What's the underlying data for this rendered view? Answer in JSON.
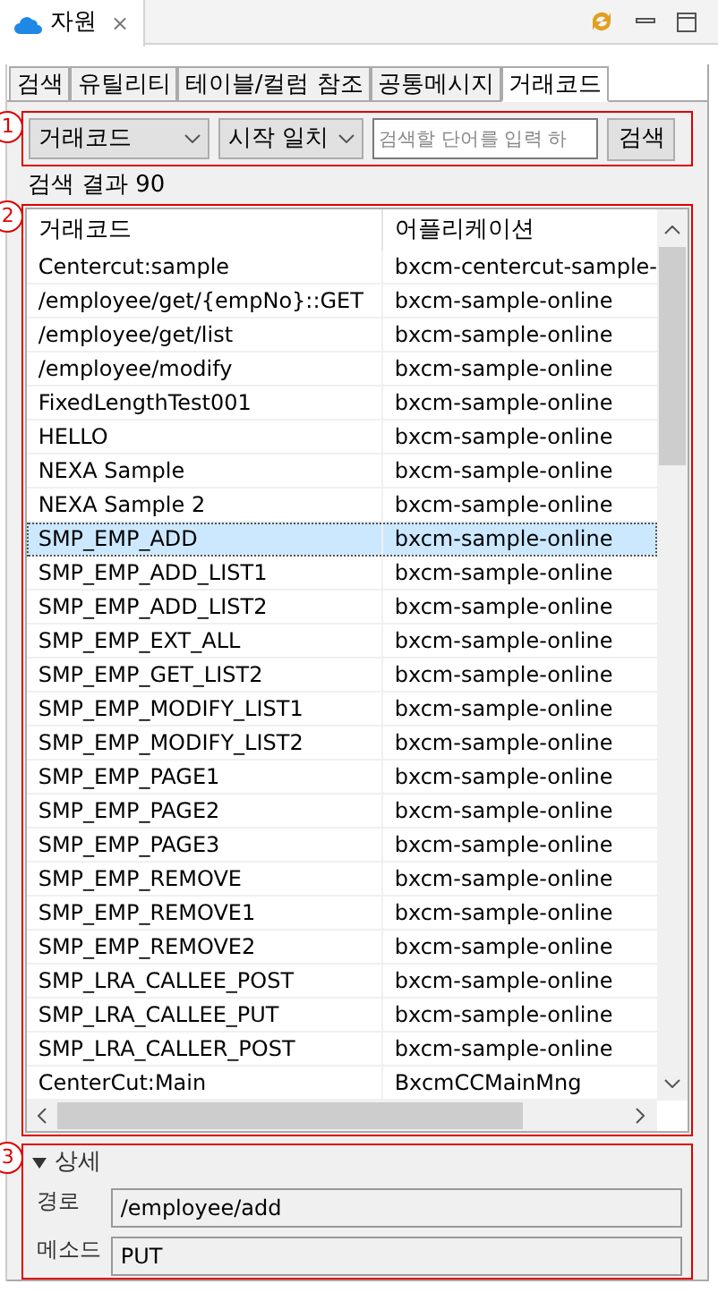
{
  "view_tab": {
    "title": "자원",
    "close": "⨯"
  },
  "tabs": [
    {
      "label": "검색",
      "selected": false
    },
    {
      "label": "유틸리티",
      "selected": false
    },
    {
      "label": "테이블/컬럼 참조",
      "selected": false
    },
    {
      "label": "공통메시지",
      "selected": false
    },
    {
      "label": "거래코드",
      "selected": true
    }
  ],
  "markers": [
    "1",
    "2",
    "3"
  ],
  "search": {
    "type_select": "거래코드",
    "match_select": "시작 일치",
    "placeholder": "검색할 단어를 입력 하",
    "button": "검색"
  },
  "result_count": "검색 결과 90",
  "table": {
    "columns": [
      "거래코드",
      "어플리케이션"
    ],
    "rows": [
      {
        "code": "Centercut:sample",
        "app": "bxcm-centercut-sample-",
        "selected": false
      },
      {
        "code": "/employee/get/{empNo}::GET",
        "app": "bxcm-sample-online",
        "selected": false
      },
      {
        "code": "/employee/get/list",
        "app": "bxcm-sample-online",
        "selected": false
      },
      {
        "code": "/employee/modify",
        "app": "bxcm-sample-online",
        "selected": false
      },
      {
        "code": "FixedLengthTest001",
        "app": "bxcm-sample-online",
        "selected": false
      },
      {
        "code": "HELLO",
        "app": "bxcm-sample-online",
        "selected": false
      },
      {
        "code": "NEXA Sample",
        "app": "bxcm-sample-online",
        "selected": false
      },
      {
        "code": "NEXA Sample 2",
        "app": "bxcm-sample-online",
        "selected": false
      },
      {
        "code": "SMP_EMP_ADD",
        "app": "bxcm-sample-online",
        "selected": true
      },
      {
        "code": "SMP_EMP_ADD_LIST1",
        "app": "bxcm-sample-online",
        "selected": false
      },
      {
        "code": "SMP_EMP_ADD_LIST2",
        "app": "bxcm-sample-online",
        "selected": false
      },
      {
        "code": "SMP_EMP_EXT_ALL",
        "app": "bxcm-sample-online",
        "selected": false
      },
      {
        "code": "SMP_EMP_GET_LIST2",
        "app": "bxcm-sample-online",
        "selected": false
      },
      {
        "code": "SMP_EMP_MODIFY_LIST1",
        "app": "bxcm-sample-online",
        "selected": false
      },
      {
        "code": "SMP_EMP_MODIFY_LIST2",
        "app": "bxcm-sample-online",
        "selected": false
      },
      {
        "code": "SMP_EMP_PAGE1",
        "app": "bxcm-sample-online",
        "selected": false
      },
      {
        "code": "SMP_EMP_PAGE2",
        "app": "bxcm-sample-online",
        "selected": false
      },
      {
        "code": "SMP_EMP_PAGE3",
        "app": "bxcm-sample-online",
        "selected": false
      },
      {
        "code": "SMP_EMP_REMOVE",
        "app": "bxcm-sample-online",
        "selected": false
      },
      {
        "code": "SMP_EMP_REMOVE1",
        "app": "bxcm-sample-online",
        "selected": false
      },
      {
        "code": "SMP_EMP_REMOVE2",
        "app": "bxcm-sample-online",
        "selected": false
      },
      {
        "code": "SMP_LRA_CALLEE_POST",
        "app": "bxcm-sample-online",
        "selected": false
      },
      {
        "code": "SMP_LRA_CALLEE_PUT",
        "app": "bxcm-sample-online",
        "selected": false
      },
      {
        "code": "SMP_LRA_CALLER_POST",
        "app": "bxcm-sample-online",
        "selected": false
      },
      {
        "code": "CenterCut:Main",
        "app": "BxcmCCMainMng",
        "selected": false
      }
    ]
  },
  "detail": {
    "title": "상세",
    "expanded": true,
    "fields": [
      {
        "label": "경로",
        "value": "/employee/add"
      },
      {
        "label": "메소드",
        "value": "PUT"
      }
    ]
  }
}
